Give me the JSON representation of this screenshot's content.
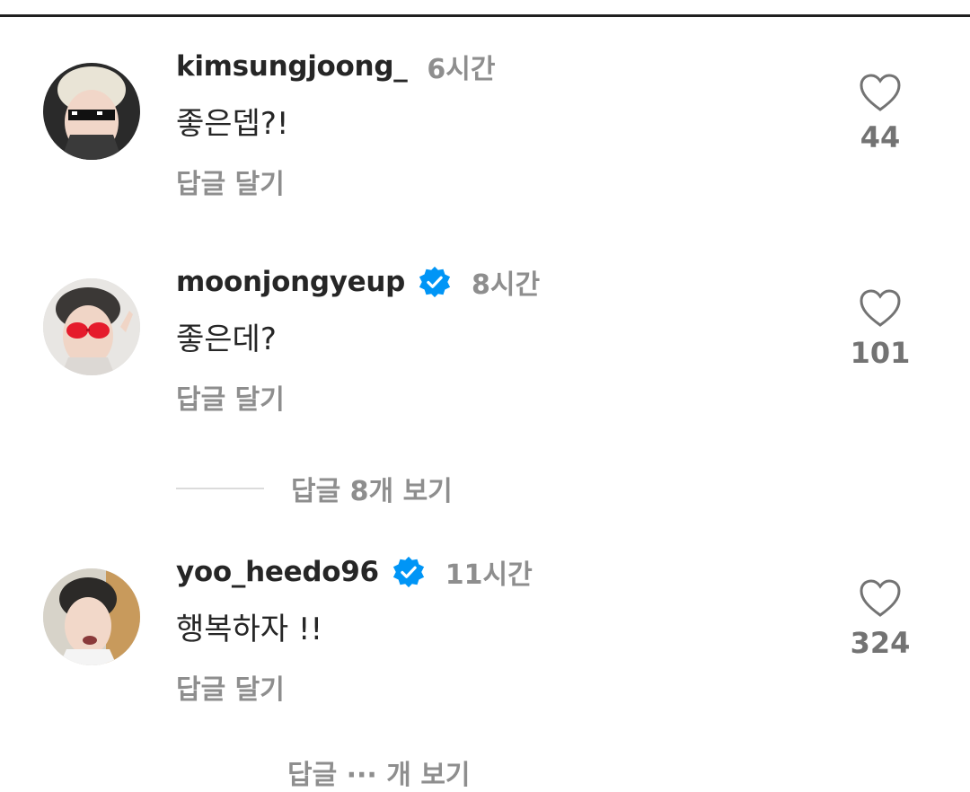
{
  "comments": [
    {
      "username": "kimsungjoong_",
      "verified": false,
      "time": "6시간",
      "text": "좋은뎁?!",
      "reply_label": "답글 달기",
      "likes": "44"
    },
    {
      "username": "moonjongyeup",
      "verified": true,
      "time": "8시간",
      "text": "좋은데?",
      "reply_label": "답글 달기",
      "likes": "101"
    },
    {
      "username": "yoo_heedo96",
      "verified": true,
      "time": "11시간",
      "text": "행복하자 !!",
      "reply_label": "답글 달기",
      "likes": "324"
    }
  ],
  "view_replies": {
    "label": "답글 8개 보기"
  },
  "cutoff_text": "답글 ··· 개 보기",
  "icons": {
    "like": "heart-outline-icon",
    "verified": "verified-badge-icon"
  },
  "colors": {
    "verified_blue": "#0095f6",
    "secondary_text": "#8e8e8e",
    "primary_text": "#262626"
  }
}
